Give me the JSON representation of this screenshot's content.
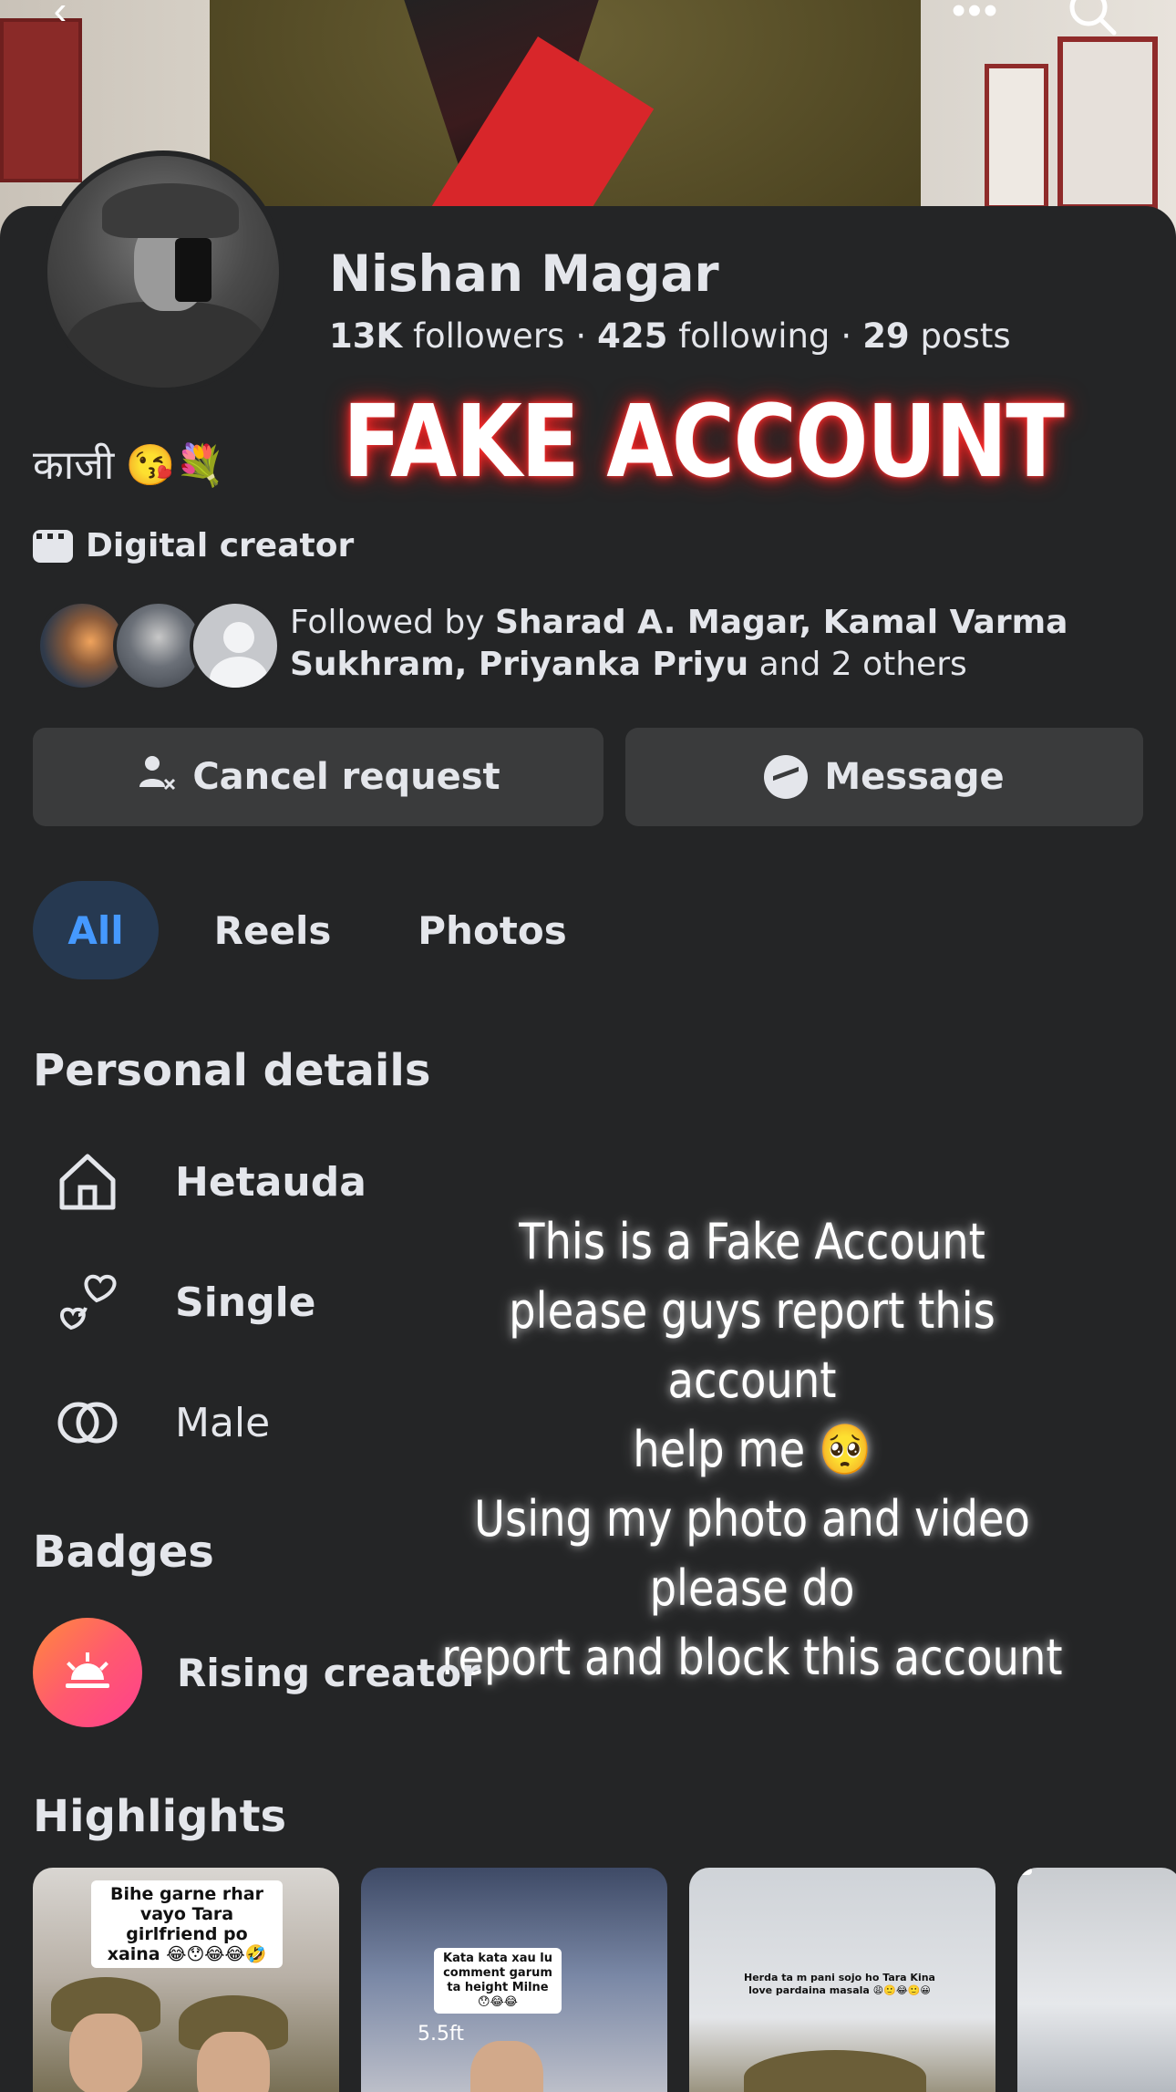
{
  "header": {
    "back_icon": "chevron-left-icon",
    "more_icon": "more-dots-icon",
    "search_icon": "search-icon"
  },
  "profile": {
    "name": "Nishan Magar",
    "followers_count": "13K",
    "followers_label": "followers",
    "following_count": "425",
    "following_label": "following",
    "posts_count": "29",
    "posts_label": "posts",
    "bio": "काजी 😘💐",
    "category": "Digital creator",
    "overlay_banner": "FAKE ACCOUNT"
  },
  "followed_by": {
    "prefix": "Followed by",
    "names": "Sharad A. Magar, Kamal Varma Sukhram, Priyanka Priyu",
    "suffix": "and 2 others"
  },
  "actions": {
    "cancel_request": "Cancel request",
    "message": "Message"
  },
  "tabs": [
    {
      "label": "All",
      "active": true
    },
    {
      "label": "Reels",
      "active": false
    },
    {
      "label": "Photos",
      "active": false
    }
  ],
  "personal_details": {
    "title": "Personal details",
    "items": [
      {
        "icon": "home-icon",
        "label": "Hetauda"
      },
      {
        "icon": "hearts-icon",
        "label": "Single"
      },
      {
        "icon": "rings-icon",
        "label": "Male"
      }
    ]
  },
  "overlay_message": {
    "line1": "This is a Fake Account",
    "line2": "please guys report this account",
    "line3": "help me 🥺",
    "line4": "Using my photo and video please do",
    "line5": "report and block this account"
  },
  "badges": {
    "title": "Badges",
    "items": [
      {
        "icon": "sunrise-icon",
        "label": "Rising creator"
      }
    ]
  },
  "highlights": {
    "title": "Highlights",
    "items": [
      {
        "caption": "Bihe garne rhar vayo Tara girlfriend po xaina 😂😯😂😂🤣"
      },
      {
        "caption": "Kata kata xau lu comment garum ta height Milne😯😂😂",
        "tag": "5.5ft"
      },
      {
        "caption": "Herda ta m pani sojo ho Tara Kina love pardaina masala 😩🙂😂🙂😀"
      },
      {
        "caption": ""
      }
    ]
  }
}
